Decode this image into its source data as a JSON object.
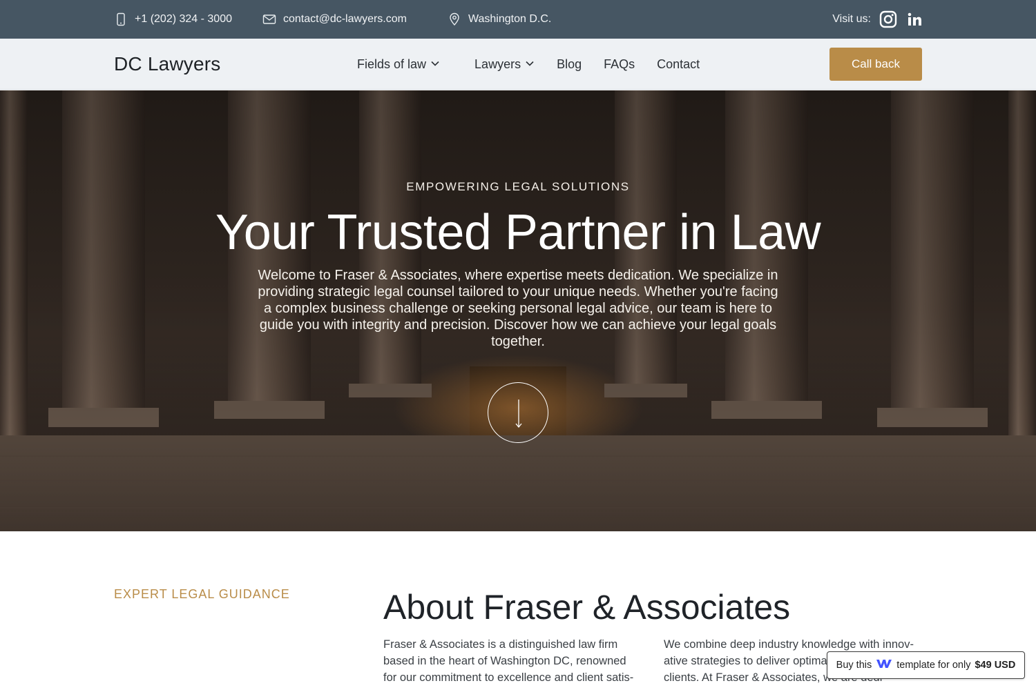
{
  "topbar": {
    "phone": "+1 (202) 324 - 3000",
    "email": "contact@dc-lawyers.com",
    "location": "Washington D.C.",
    "visit_label": "Visit us:",
    "social": [
      {
        "name": "Instagram",
        "icon": "instagram-icon"
      },
      {
        "name": "LinkedIn",
        "icon": "linkedin-icon"
      }
    ]
  },
  "nav": {
    "brand": "DC Lawyers",
    "items": [
      {
        "label": "Fields of law",
        "has_dropdown": true
      },
      {
        "label": "Lawyers",
        "has_dropdown": true
      },
      {
        "label": "Blog",
        "has_dropdown": false
      },
      {
        "label": "FAQs",
        "has_dropdown": false
      },
      {
        "label": "Contact",
        "has_dropdown": false
      }
    ],
    "cta": "Call back"
  },
  "hero": {
    "eyebrow": "EMPOWERING LEGAL SOLUTIONS",
    "title": "Your Trusted Partner in Law",
    "lead": "Welcome to Fraser & Associates, where expertise meets dedication. We specialize in providing strategic legal counsel tailored to your unique needs. Whether you're facing a complex business challenge or seeking personal legal advice, our team is here to guide you with integrity and precision. Discover how we can achieve your legal goals together.",
    "scroll_icon": "arrow-down-icon"
  },
  "about": {
    "eyebrow": "EXPERT LEGAL GUIDANCE",
    "title": "About Fraser & Associates",
    "col1": "Fraser & Associates is a distinguished law firm based in the heart of Washington DC, renowned for our commitment to excellence and client satis-",
    "col2": "We combine deep industry knowledge with innov-ative strategies to deliver optimal outcomes for our clients. At Fraser & Associates, we are dedi-"
  },
  "buy_badge": {
    "prefix": "Buy this",
    "middle": "template for only",
    "price": "$49 USD",
    "icon": "webflow-icon"
  },
  "colors": {
    "topbar": "#465663",
    "navbar": "#eef1f4",
    "accent": "#b98c48",
    "text_dark": "#1f2328"
  }
}
